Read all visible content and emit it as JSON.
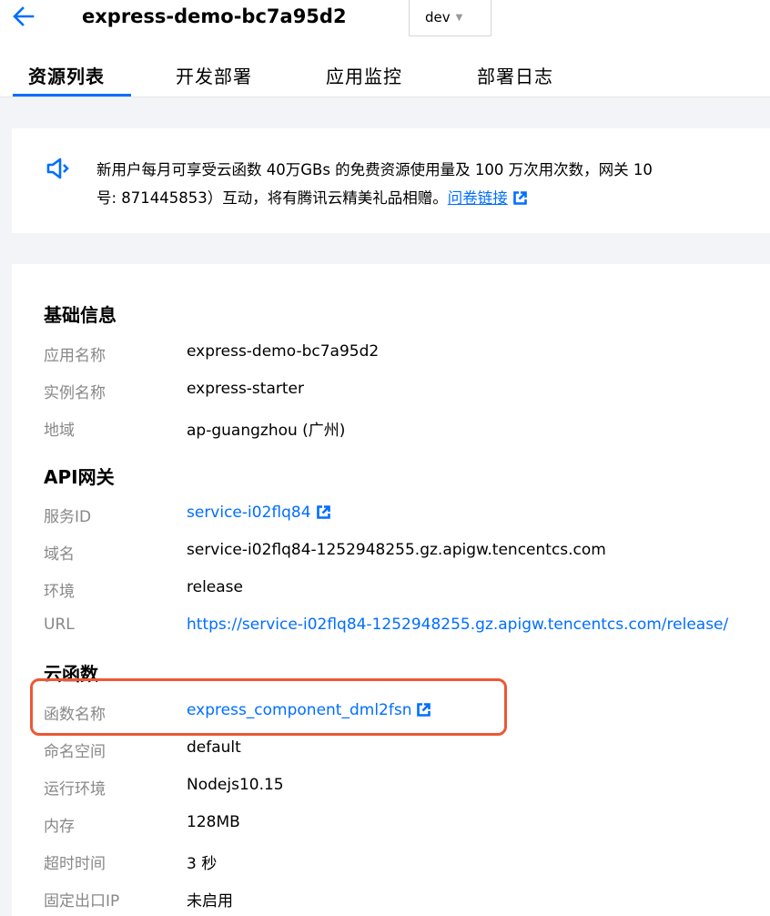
{
  "header": {
    "app_name": "express-demo-bc7a95d2",
    "env": "dev"
  },
  "tabs": [
    {
      "label": "资源列表"
    },
    {
      "label": "开发部署"
    },
    {
      "label": "应用监控"
    },
    {
      "label": "部署日志"
    }
  ],
  "notice": {
    "line1": "新用户每月可享受云函数 40万GBs 的免费资源使用量及 100 万次用次数，网关 10",
    "line2_text": "号: 871445853）互动，将有腾讯云精美礼品相赠。",
    "survey_link": "问卷链接"
  },
  "basic": {
    "title": "基础信息",
    "rows": [
      {
        "key": "应用名称",
        "value": "express-demo-bc7a95d2"
      },
      {
        "key": "实例名称",
        "value": "express-starter"
      },
      {
        "key": "地域",
        "value": "ap-guangzhou (广州)"
      }
    ]
  },
  "api": {
    "title": "API网关",
    "rows": [
      {
        "key": "服务ID",
        "value": "service-i02flq84"
      },
      {
        "key": "域名",
        "value": "service-i02flq84-1252948255.gz.apigw.tencentcs.com"
      },
      {
        "key": "环境",
        "value": "release"
      },
      {
        "key": "URL",
        "value": "https://service-i02flq84-1252948255.gz.apigw.tencentcs.com/release/"
      }
    ]
  },
  "scf": {
    "title": "云函数",
    "rows": [
      {
        "key": "函数名称",
        "value": "express_component_dml2fsn"
      },
      {
        "key": "命名空间",
        "value": "default"
      },
      {
        "key": "运行环境",
        "value": "Nodejs10.15"
      },
      {
        "key": "内存",
        "value": "128MB"
      },
      {
        "key": "超时时间",
        "value": "3 秒"
      },
      {
        "key": "固定出口IP",
        "value": "未启用"
      }
    ]
  },
  "colors": {
    "accent": "#006eff",
    "highlight": "#ee5733"
  },
  "icons": {
    "back": "arrow-left-icon",
    "notice": "speaker-icon",
    "external": "external-link-icon",
    "dropdown": "caret-down-icon"
  }
}
